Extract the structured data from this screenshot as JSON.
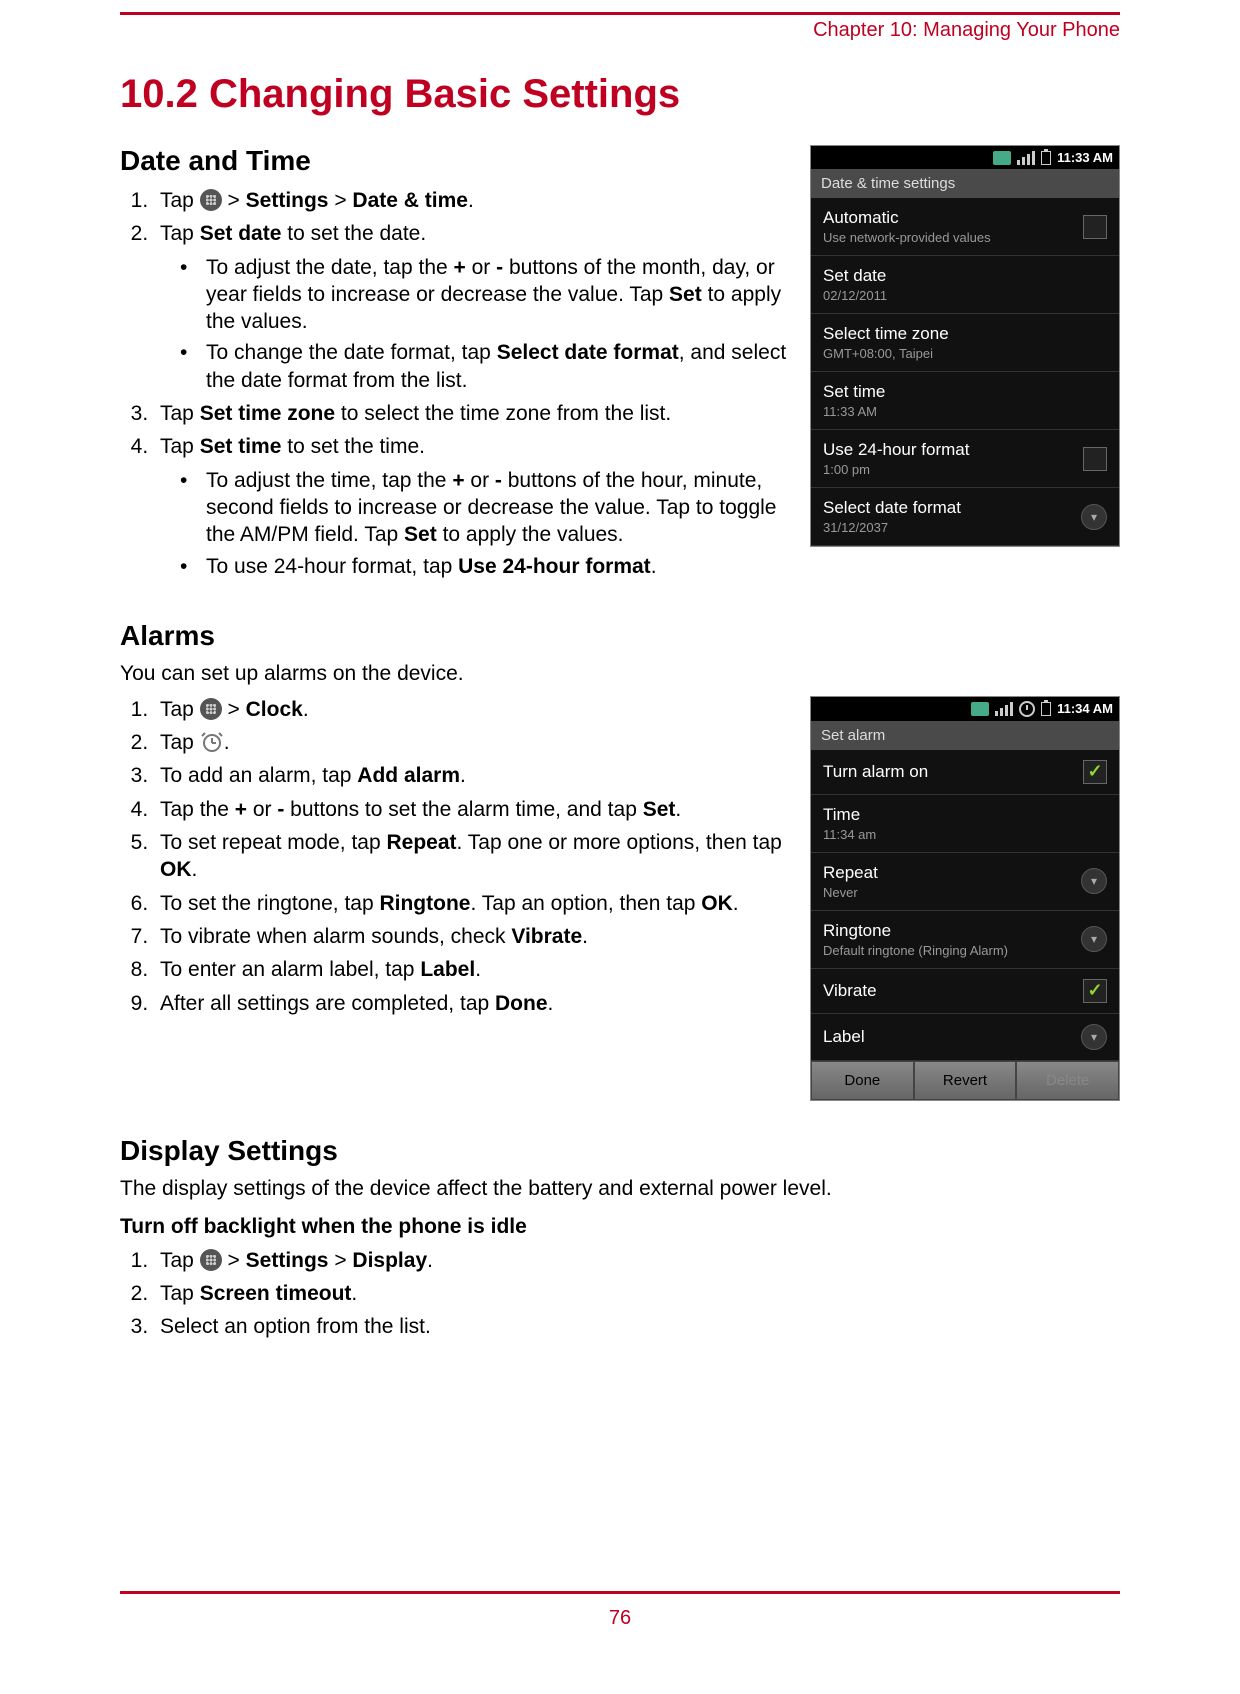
{
  "chapter": "Chapter 10: Managing Your Phone",
  "page_number": "76",
  "section_title": "10.2 Changing Basic Settings",
  "date_time": {
    "heading": "Date and Time",
    "step1_a": "Tap ",
    "step1_b": " > ",
    "step1_c": "Settings",
    "step1_d": " > ",
    "step1_e": "Date & time",
    "step1_f": ".",
    "step2_a": "Tap ",
    "step2_b": "Set date",
    "step2_c": " to set the date.",
    "step2_sub1_a": "To adjust the date, tap the ",
    "step2_sub1_b": "+",
    "step2_sub1_c": " or ",
    "step2_sub1_d": "-",
    "step2_sub1_e": " buttons of the month, day, or year fields to increase or decrease the value. Tap ",
    "step2_sub1_f": "Set",
    "step2_sub1_g": " to apply the values.",
    "step2_sub2_a": "To change the date format, tap ",
    "step2_sub2_b": "Select date format",
    "step2_sub2_c": ", and select the date format from the list.",
    "step3_a": "Tap ",
    "step3_b": "Set time zone",
    "step3_c": " to select the time zone from the list.",
    "step4_a": "Tap ",
    "step4_b": "Set time",
    "step4_c": " to set the time.",
    "step4_sub1_a": "To adjust the time, tap the ",
    "step4_sub1_b": "+",
    "step4_sub1_c": " or ",
    "step4_sub1_d": "-",
    "step4_sub1_e": " buttons of the hour, minute, second fields to increase or decrease the value. Tap to toggle the AM/PM field. Tap ",
    "step4_sub1_f": "Set",
    "step4_sub1_g": " to apply the values.",
    "step4_sub2_a": "To use 24-hour format, tap ",
    "step4_sub2_b": "Use 24-hour format",
    "step4_sub2_c": "."
  },
  "alarms": {
    "heading": "Alarms",
    "lead": "You can set up alarms on the device.",
    "s1_a": "Tap ",
    "s1_b": " > ",
    "s1_c": "Clock",
    "s1_d": ".",
    "s2_a": "Tap ",
    "s3_a": "To add an alarm, tap ",
    "s3_b": "Add alarm",
    "s3_c": ".",
    "s4_a": "Tap the ",
    "s4_b": "+",
    "s4_c": " or ",
    "s4_d": "-",
    "s4_e": " buttons to set the alarm time, and tap ",
    "s4_f": "Set",
    "s4_g": ".",
    "s5_a": "To set repeat mode, tap ",
    "s5_b": "Repeat",
    "s5_c": ". Tap one or more options, then tap ",
    "s5_d": "OK",
    "s5_e": ".",
    "s6_a": "To set the ringtone, tap ",
    "s6_b": "Ringtone",
    "s6_c": ". Tap an option, then tap ",
    "s6_d": "OK",
    "s6_e": ".",
    "s7_a": "To vibrate when alarm sounds, check ",
    "s7_b": "Vibrate",
    "s7_c": ".",
    "s8_a": "To enter an alarm label, tap ",
    "s8_b": "Label",
    "s8_c": ".",
    "s9_a": "After all settings are completed, tap ",
    "s9_b": "Done",
    "s9_c": "."
  },
  "display": {
    "heading": "Display Settings",
    "lead": "The display settings of the device affect the battery and external power level.",
    "sub_bold": "Turn off backlight when the phone is idle",
    "s1_a": "Tap ",
    "s1_b": " > ",
    "s1_c": "Settings",
    "s1_d": " > ",
    "s1_e": "Display",
    "s1_f": ".",
    "s2_a": "Tap ",
    "s2_b": "Screen timeout",
    "s2_c": ".",
    "s3": "Select an option from the list."
  },
  "phone1": {
    "time": "11:33 AM",
    "title": "Date & time settings",
    "automatic": "Automatic",
    "automatic_sub": "Use network-provided values",
    "set_date": "Set date",
    "set_date_sub": "02/12/2011",
    "tz": "Select time zone",
    "tz_sub": "GMT+08:00, Taipei",
    "set_time": "Set time",
    "set_time_sub": "11:33 AM",
    "use24": "Use 24-hour format",
    "use24_sub": "1:00 pm",
    "datefmt": "Select date format",
    "datefmt_sub": "31/12/2037"
  },
  "phone2": {
    "time": "11:34 AM",
    "title": "Set alarm",
    "turn_on": "Turn alarm on",
    "time_l": "Time",
    "time_v": "11:34 am",
    "repeat": "Repeat",
    "repeat_v": "Never",
    "ringtone": "Ringtone",
    "ringtone_v": "Default ringtone (Ringing Alarm)",
    "vibrate": "Vibrate",
    "label": "Label",
    "done": "Done",
    "revert": "Revert",
    "delete": "Delete"
  }
}
